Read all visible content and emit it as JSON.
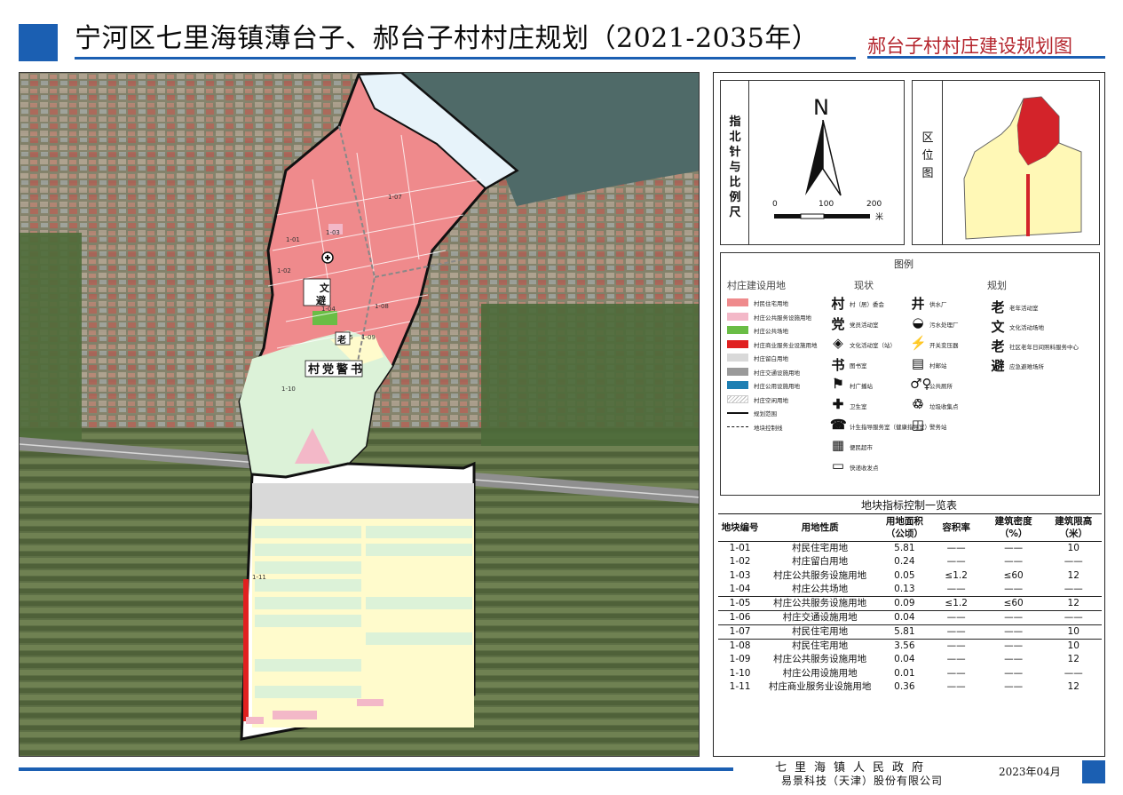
{
  "header": {
    "title": "宁河区七里海镇薄台子、郝台子村村庄规划（2021-2035年）",
    "subtitle": "郝台子村村庄建设规划图"
  },
  "colors": {
    "accent_blue": "#1b5fb2",
    "subtitle_red": "#b4252d",
    "residential": "#ef8a8c",
    "public_service": "#f3b8c8",
    "public_space": "#6abd45",
    "commercial": "#e02020",
    "reserved": "#d9d9d9",
    "transport": "#9a9a9a",
    "utilities": "#1e7fb3",
    "unused": "#e7f3fa",
    "nonbuild_green": "#dcf2d8",
    "farmland_yellow": "#fffbcc"
  },
  "map": {
    "parcel_labels": [
      "1-01",
      "1-02",
      "1-03",
      "1-04",
      "1-05",
      "1-07",
      "1-08",
      "1-09",
      "1-10",
      "1-11"
    ],
    "symbols": [
      "村",
      "党",
      "警",
      "书",
      "文",
      "避",
      "老"
    ]
  },
  "north_panel": {
    "label": "指北针与比例尺",
    "north": "N",
    "scale_ticks": [
      "0",
      "100",
      "200"
    ],
    "scale_unit": "米"
  },
  "location_panel": {
    "label": "区位图"
  },
  "legend": {
    "title": "图例",
    "landuse_heading": "村庄建设用地",
    "status_heading": "现状",
    "plan_heading": "规划",
    "landuse_items": [
      {
        "label": "村民住宅用地",
        "color": "#ef8a8c",
        "style": "fill"
      },
      {
        "label": "村庄公共服务设施用地",
        "color": "#f3b8c8",
        "style": "fill"
      },
      {
        "label": "村庄公共场地",
        "color": "#6abd45",
        "style": "fill"
      },
      {
        "label": "村庄商业服务业设施用地",
        "color": "#e02020",
        "style": "fill"
      },
      {
        "label": "村庄留白用地",
        "color": "#d9d9d9",
        "style": "fill"
      },
      {
        "label": "村庄交通设施用地",
        "color": "#9a9a9a",
        "style": "fill"
      },
      {
        "label": "村庄公用设施用地",
        "color": "#1e7fb3",
        "style": "fill"
      },
      {
        "label": "村庄空闲用地",
        "color": "#ffffff",
        "style": "hatch"
      },
      {
        "label": "规划范围",
        "color": "#111111",
        "style": "line"
      },
      {
        "label": "地块控制线",
        "color": "#111111",
        "style": "dash"
      }
    ],
    "status_col1": [
      {
        "symbol": "村",
        "label": "村（居）委会"
      },
      {
        "symbol": "党",
        "label": "党员活动室"
      },
      {
        "symbol": "◈",
        "label": "文化活动室（站）"
      },
      {
        "symbol": "书",
        "label": "图书室"
      },
      {
        "symbol": "⚑",
        "label": "村广播站"
      },
      {
        "symbol": "✚",
        "label": "卫生室"
      },
      {
        "symbol": "☎",
        "label": "计生指导服务室（健康指导室）"
      },
      {
        "symbol": "▦",
        "label": "便民超市"
      },
      {
        "symbol": "▭",
        "label": "快递收发点"
      }
    ],
    "status_col2": [
      {
        "symbol": "井",
        "label": "供水厂"
      },
      {
        "symbol": "◒",
        "label": "污水处理厂"
      },
      {
        "symbol": "⚡",
        "label": "开关变压器"
      },
      {
        "symbol": "▤",
        "label": "村邮站"
      },
      {
        "symbol": "♂♀",
        "label": "公共厕所"
      },
      {
        "symbol": "♲",
        "label": "垃圾收集点"
      },
      {
        "symbol": "◫",
        "label": "警务站"
      }
    ],
    "plan_items": [
      {
        "symbol": "老",
        "label": "老年活动室"
      },
      {
        "symbol": "文",
        "label": "文化活动场地"
      },
      {
        "symbol": "老",
        "label": "社区老年日间照料服务中心"
      },
      {
        "symbol": "避",
        "label": "应急避难场所"
      }
    ]
  },
  "table": {
    "title": "地块指标控制一览表",
    "headers": [
      "地块编号",
      "用地性质",
      "用地面积（公顷）",
      "容积率",
      "建筑密度（%）",
      "建筑限高（米）"
    ],
    "rows": [
      [
        "1-01",
        "村民住宅用地",
        "5.81",
        "——",
        "——",
        "10"
      ],
      [
        "1-02",
        "村庄留白用地",
        "0.24",
        "——",
        "——",
        "——"
      ],
      [
        "1-03",
        "村庄公共服务设施用地",
        "0.05",
        "≤1.2",
        "≤60",
        "12"
      ],
      [
        "1-04",
        "村庄公共场地",
        "0.13",
        "——",
        "——",
        "——"
      ],
      [
        "1-05",
        "村庄公共服务设施用地",
        "0.09",
        "≤1.2",
        "≤60",
        "12"
      ],
      [
        "1-06",
        "村庄交通设施用地",
        "0.04",
        "——",
        "——",
        "——"
      ],
      [
        "1-07",
        "村民住宅用地",
        "5.81",
        "——",
        "——",
        "10"
      ],
      [
        "1-08",
        "村民住宅用地",
        "3.56",
        "——",
        "——",
        "10"
      ],
      [
        "1-09",
        "村庄公共服务设施用地",
        "0.04",
        "——",
        "——",
        "12"
      ],
      [
        "1-10",
        "村庄公用设施用地",
        "0.01",
        "——",
        "——",
        "——"
      ],
      [
        "1-11",
        "村庄商业服务业设施用地",
        "0.36",
        "——",
        "——",
        "12"
      ]
    ]
  },
  "footer": {
    "gov": "七里海镇人民政府",
    "company": "易景科技（天津）股份有限公司",
    "date": "2023年04月"
  }
}
